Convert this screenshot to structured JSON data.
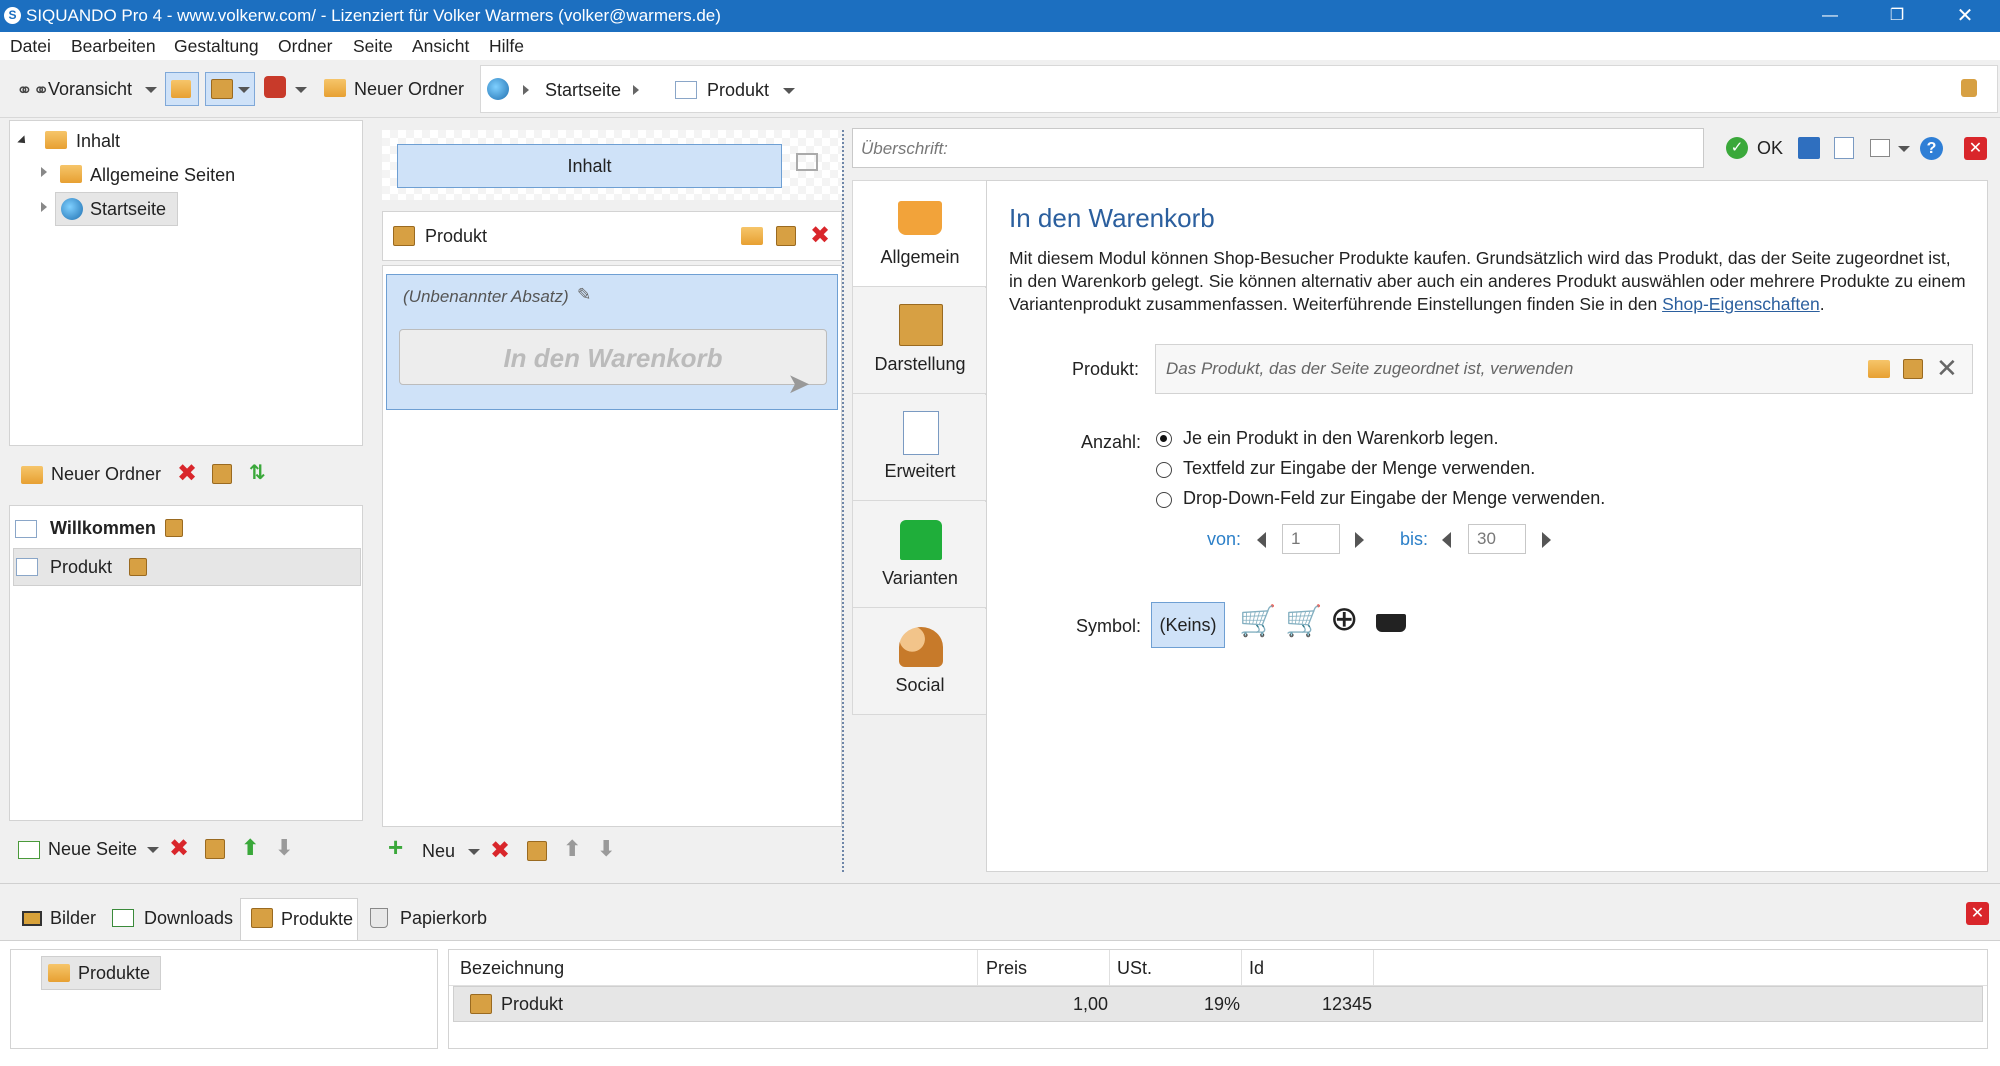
{
  "window": {
    "title": "SIQUANDO Pro 4 - www.volkerw.com/ - Lizenziert für Volker Warmers (volker@warmers.de)"
  },
  "menu": [
    "Datei",
    "Bearbeiten",
    "Gestaltung",
    "Ordner",
    "Seite",
    "Ansicht",
    "Hilfe"
  ],
  "toolbar": {
    "preview": "Voransicht",
    "new_folder": "Neuer Ordner",
    "crumb_home": "Startseite",
    "crumb_page": "Produkt"
  },
  "tree": {
    "root": "Inhalt",
    "items": [
      "Allgemeine Seiten",
      "Startseite"
    ]
  },
  "folder_actions": {
    "new_folder": "Neuer Ordner"
  },
  "pages": {
    "items": [
      "Willkommen",
      "Produkt"
    ],
    "new_page": "Neue Seite"
  },
  "middle": {
    "content_tab": "Inhalt",
    "module_title": "Produkt",
    "paragraph_name": "(Unbenannter Absatz)",
    "preview_button": "In den Warenkorb",
    "new_label": "Neu"
  },
  "editor": {
    "heading_placeholder": "Überschrift:",
    "ok": "OK",
    "tabs": [
      "Allgemein",
      "Darstellung",
      "Erweitert",
      "Varianten",
      "Social"
    ],
    "title": "In den Warenkorb",
    "desc": "Mit diesem Modul können Shop-Besucher Produkte kaufen. Grundsätzlich wird das Produkt, das der Seite zugeordnet ist, in den Warenkorb gelegt. Sie können alternativ aber auch ein anderes Produkt auswählen oder mehrere Produkte zu einem Variantenprodukt zusammenfassen. Weiterführende Einstellungen finden Sie in den ",
    "desc_link": "Shop-Eigenschaften",
    "desc_end": ".",
    "product_label": "Produkt:",
    "product_placeholder": "Das Produkt, das der Seite zugeordnet ist, verwenden",
    "count_label": "Anzahl:",
    "options": [
      "Je ein Produkt in den Warenkorb legen.",
      "Textfeld zur Eingabe der Menge verwenden.",
      "Drop-Down-Feld zur Eingabe der Menge verwenden."
    ],
    "selected_option": 0,
    "from_label": "von:",
    "from_value": "1",
    "to_label": "bis:",
    "to_value": "30",
    "symbol_label": "Symbol:",
    "symbol_none": "(Keins)"
  },
  "bottom": {
    "tabs": [
      "Bilder",
      "Downloads",
      "Produkte",
      "Papierkorb"
    ],
    "active_tab": 2,
    "tree_item": "Produkte",
    "columns": [
      "Bezeichnung",
      "Preis",
      "USt.",
      "Id"
    ],
    "rows": [
      {
        "name": "Produkt",
        "price": "1,00",
        "vat": "19%",
        "id": "12345"
      }
    ]
  },
  "colors": {
    "titlebar": "#1c6fc0",
    "accent": "#2b5f9e",
    "selection": "#cfe2f8"
  }
}
